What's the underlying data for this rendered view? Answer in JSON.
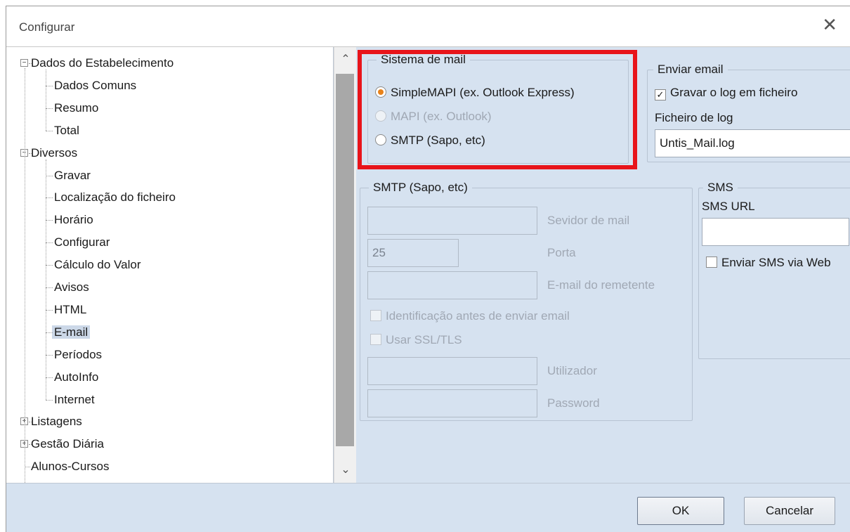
{
  "window": {
    "title": "Configurar",
    "close_glyph": "✕"
  },
  "tree": {
    "items": [
      {
        "label": "Dados do Estabelecimento",
        "level": 0,
        "expander": "−"
      },
      {
        "label": "Dados Comuns",
        "level": 1
      },
      {
        "label": "Resumo",
        "level": 1
      },
      {
        "label": "Total",
        "level": 1
      },
      {
        "label": "Diversos",
        "level": 0,
        "expander": "−"
      },
      {
        "label": "Gravar",
        "level": 1
      },
      {
        "label": "Localização do ficheiro",
        "level": 1
      },
      {
        "label": "Horário",
        "level": 1
      },
      {
        "label": "Configurar",
        "level": 1
      },
      {
        "label": "Cálculo do Valor",
        "level": 1
      },
      {
        "label": "Avisos",
        "level": 1
      },
      {
        "label": "HTML",
        "level": 1
      },
      {
        "label": "E-mail",
        "level": 1,
        "selected": true
      },
      {
        "label": "Períodos",
        "level": 1
      },
      {
        "label": "AutoInfo",
        "level": 1
      },
      {
        "label": "Internet",
        "level": 1
      },
      {
        "label": "Listagens",
        "level": 0,
        "expander": "+"
      },
      {
        "label": "Gestão Diária",
        "level": 0,
        "expander": "+"
      },
      {
        "label": "Alunos-Cursos",
        "level": 0
      }
    ],
    "scroll_up": "⌃",
    "scroll_down": "⌄"
  },
  "mail_system": {
    "legend": "Sistema de mail",
    "options": [
      {
        "label": "SimpleMAPI (ex. Outlook Express)",
        "selected": true,
        "enabled": true
      },
      {
        "label": "MAPI (ex. Outlook)",
        "selected": false,
        "enabled": false
      },
      {
        "label": "SMTP (Sapo, etc)",
        "selected": false,
        "enabled": true
      }
    ]
  },
  "send_email": {
    "legend": "Enviar email",
    "log_checkbox": "Gravar o log em ficheiro",
    "log_checked": true,
    "log_file_label": "Ficheiro de log",
    "log_file_value": "Untis_Mail.log"
  },
  "smtp": {
    "legend": "SMTP (Sapo, etc)",
    "server_label": "Sevidor de mail",
    "server_value": "",
    "port_label": "Porta",
    "port_value": "25",
    "sender_label": "E-mail do remetente",
    "sender_value": "",
    "auth_checkbox": "Identificação antes de enviar email",
    "ssl_checkbox": "Usar SSL/TLS",
    "user_label": "Utilizador",
    "user_value": "",
    "password_label": "Password",
    "password_value": ""
  },
  "sms": {
    "legend": "SMS",
    "url_label": "SMS URL",
    "url_value": "",
    "web_checkbox": "Enviar SMS via Web"
  },
  "footer": {
    "ok": "OK",
    "cancel": "Cancelar"
  },
  "colors": {
    "highlight": "#e8141a",
    "radio_selected": "#e8821a",
    "panel_bg": "#d6e2f0"
  }
}
